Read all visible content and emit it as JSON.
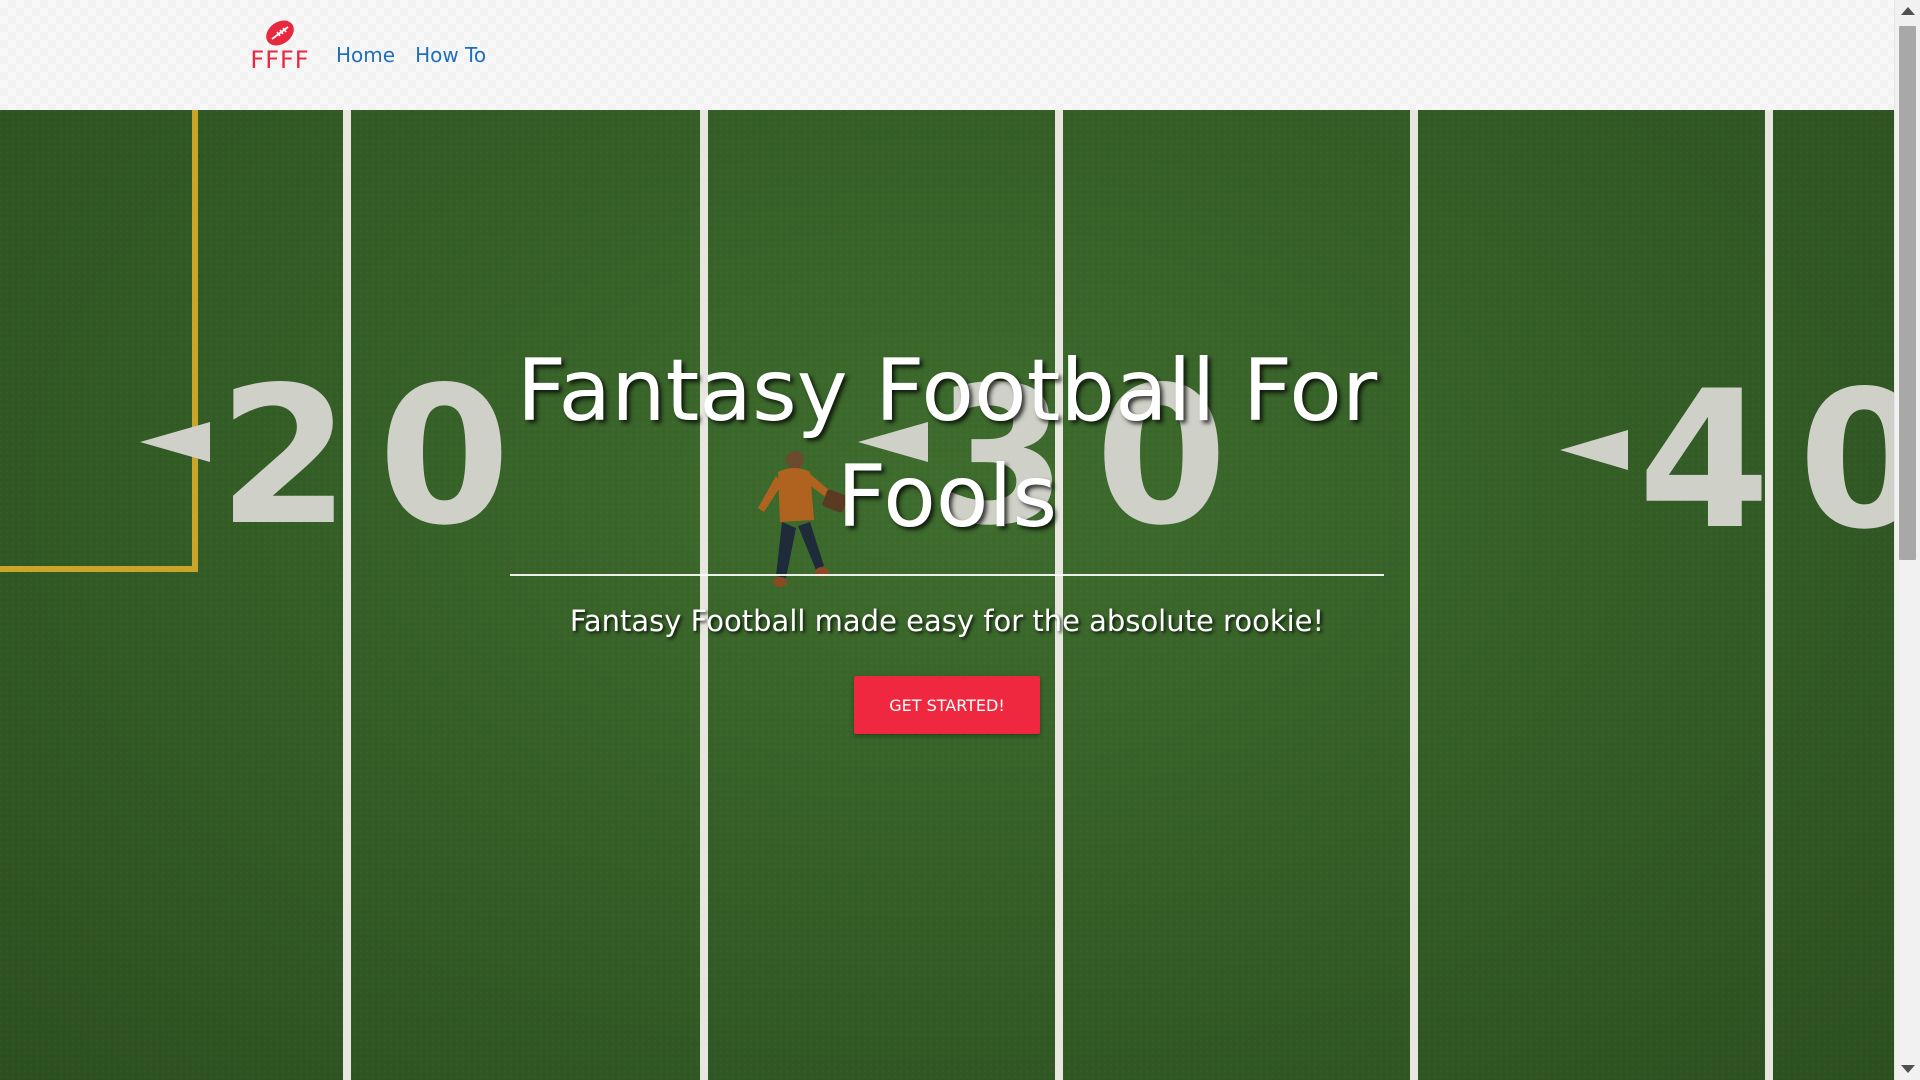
{
  "navbar": {
    "logo_icon": "football-icon",
    "brand_text": "FFFF",
    "links": [
      {
        "label": "Home"
      },
      {
        "label": "How To"
      }
    ]
  },
  "hero": {
    "title": "Fantasy Football For Fools",
    "subtitle": "Fantasy Football made easy for the absolute rookie!",
    "cta_label": "GET STARTED!",
    "field_numbers": [
      "20",
      "30",
      "40"
    ]
  },
  "colors": {
    "brand_red": "#e8283f",
    "link_blue": "#1f6fb8",
    "button_red": "#f0283f",
    "turf_green": "#355f27"
  }
}
